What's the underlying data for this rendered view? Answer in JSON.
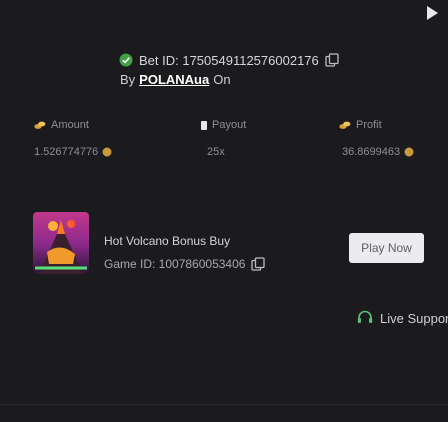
{
  "bet": {
    "id_label": "Bet ID: 1750549112576002176",
    "by_prefix": "By",
    "username": "POLANAua",
    "on_label": "On"
  },
  "stats": {
    "amount_label": "Amount",
    "amount_value": "1.526774776",
    "multiplier_label": "Payout",
    "multiplier_value": "25x",
    "profit_label": "Profit",
    "profit_value": "36.8699463"
  },
  "game": {
    "name": "Hot Volcano Bonus Buy",
    "id_label": "Game ID: 1007860053406",
    "play_label": "Play Now"
  },
  "support": {
    "label": "Live Support"
  },
  "colors": {
    "background": "#1b1b1e",
    "accent_green": "#4caf50",
    "accent_gold": "#e0b64a",
    "button_bg": "#ececee"
  },
  "icons": [
    "play-icon",
    "shield-check-icon",
    "copy-icon",
    "coins-icon",
    "multiplier-icon",
    "profit-icon",
    "live-support-icon"
  ]
}
